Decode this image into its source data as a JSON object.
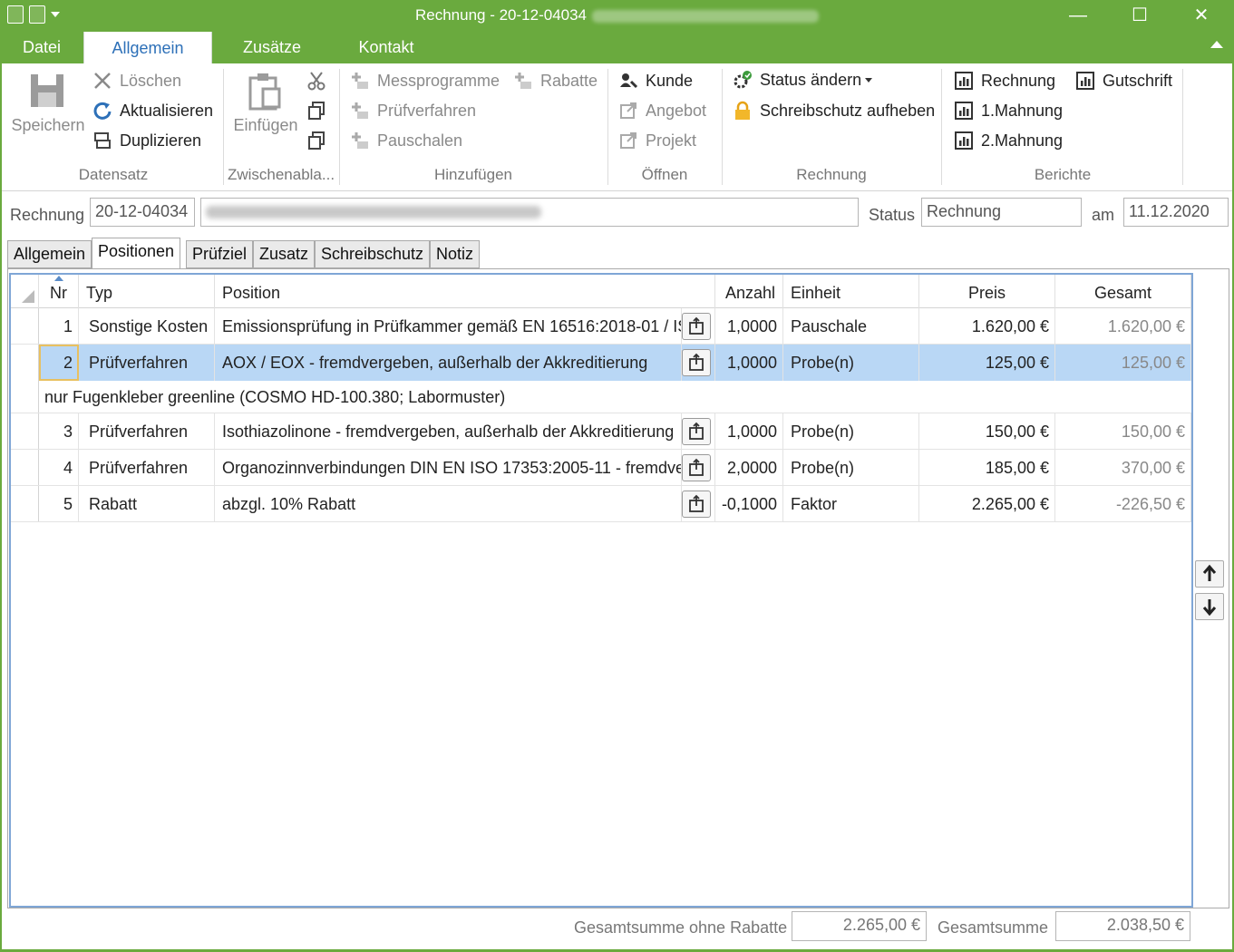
{
  "window": {
    "title": "Rechnung - 20-12-04034",
    "controls": {
      "minimize": "—",
      "maximize": "☐",
      "close": "✕"
    }
  },
  "ribbon_tabs": [
    "Datei",
    "Allgemein",
    "Zusätze",
    "Kontakt"
  ],
  "ribbon": {
    "datensatz": {
      "label": "Datensatz",
      "speichern": "Speichern",
      "loeschen": "Löschen",
      "aktualisieren": "Aktualisieren",
      "duplizieren": "Duplizieren"
    },
    "zwischenablage": {
      "label": "Zwischenabla...",
      "einfuegen": "Einfügen"
    },
    "hinzufuegen": {
      "label": "Hinzufügen",
      "messprogramme": "Messprogramme",
      "rabatte": "Rabatte",
      "pruefverfahren": "Prüfverfahren",
      "pauschalen": "Pauschalen"
    },
    "oeffnen": {
      "label": "Öffnen",
      "kunde": "Kunde",
      "angebot": "Angebot",
      "projekt": "Projekt"
    },
    "rechnung": {
      "label": "Rechnung",
      "status_aendern": "Status ändern",
      "schreibschutz": "Schreibschutz aufheben"
    },
    "berichte": {
      "label": "Berichte",
      "rechnung": "Rechnung",
      "mahnung1": "1.Mahnung",
      "mahnung2": "2.Mahnung",
      "gutschrift": "Gutschrift"
    }
  },
  "header": {
    "rechnung_label": "Rechnung",
    "rechnung_nr": "20-12-04034",
    "status_label": "Status",
    "status_value": "Rechnung",
    "am_label": "am",
    "date": "11.12.2020"
  },
  "tabs": [
    "Allgemein",
    "Positionen",
    "Prüfziel",
    "Zusatz",
    "Schreibschutz",
    "Notiz"
  ],
  "grid": {
    "columns": {
      "nr": "Nr",
      "typ": "Typ",
      "position": "Position",
      "anzahl": "Anzahl",
      "einheit": "Einheit",
      "preis": "Preis",
      "gesamt": "Gesamt"
    },
    "rows": [
      {
        "nr": "1",
        "typ": "Sonstige Kosten",
        "position": "Emissionsprüfung in Prüfkammer gemäß EN 16516:2018-01 / IS",
        "anzahl": "1,0000",
        "einheit": "Pauschale",
        "preis": "1.620,00 €",
        "gesamt": "1.620,00 €"
      },
      {
        "nr": "2",
        "typ": "Prüfverfahren",
        "position": "AOX / EOX - fremdvergeben, außerhalb der Akkreditierung",
        "anzahl": "1,0000",
        "einheit": "Probe(n)",
        "preis": "125,00 €",
        "gesamt": "125,00 €",
        "note": "nur Fugenkleber greenline (COSMO HD-100.380; Labormuster)"
      },
      {
        "nr": "3",
        "typ": "Prüfverfahren",
        "position": "Isothiazolinone - fremdvergeben, außerhalb der Akkreditierung",
        "anzahl": "1,0000",
        "einheit": "Probe(n)",
        "preis": "150,00 €",
        "gesamt": "150,00 €"
      },
      {
        "nr": "4",
        "typ": "Prüfverfahren",
        "position": "Organozinnverbindungen DIN EN ISO 17353:2005-11 - fremdve",
        "anzahl": "2,0000",
        "einheit": "Probe(n)",
        "preis": "185,00 €",
        "gesamt": "370,00 €"
      },
      {
        "nr": "5",
        "typ": "Rabatt",
        "position": "abzgl. 10% Rabatt",
        "anzahl": "-0,1000",
        "einheit": "Faktor",
        "preis": "2.265,00 €",
        "gesamt": "-226,50 €"
      }
    ]
  },
  "footer": {
    "sum_no_discount_label": "Gesamtsumme ohne Rabatte",
    "sum_no_discount": "2.265,00 €",
    "sum_label": "Gesamtsumme",
    "sum": "2.038,50 €"
  },
  "colors": {
    "accent": "#6aaa3e",
    "selection": "#b9d7f5",
    "grid_border": "#7fa6d6",
    "link_blue": "#2d70b8"
  }
}
